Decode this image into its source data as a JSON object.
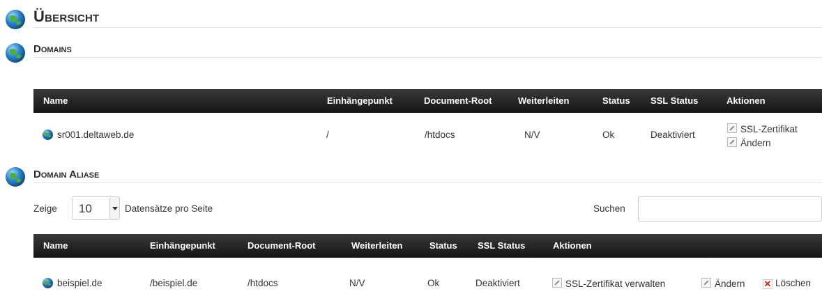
{
  "overview": {
    "title": "Übersicht"
  },
  "domains": {
    "title": "Domains",
    "headers": {
      "name": "Name",
      "mount": "Einhängepunkt",
      "docroot": "Document-Root",
      "redirect": "Weiterleiten",
      "status": "Status",
      "ssl": "SSL Status",
      "actions": "Aktionen"
    },
    "row": {
      "name": "sr001.deltaweb.de",
      "mount": "/",
      "docroot": "/htdocs",
      "redirect": "N/V",
      "status": "Ok",
      "ssl": "Deaktiviert",
      "action_ssl": "SSL-Zertifikat",
      "action_edit": "Ändern"
    }
  },
  "aliases": {
    "title": "Domain Aliase",
    "show_label": "Zeige",
    "page_size": "10",
    "per_page_label": "Datensätze pro Seite",
    "search_label": "Suchen",
    "search_value": "",
    "headers": {
      "name": "Name",
      "mount": "Einhängepunkt",
      "docroot": "Document-Root",
      "redirect": "Weiterleiten",
      "status": "Status",
      "ssl": "SSL Status",
      "actions": "Aktionen"
    },
    "row": {
      "name": "beispiel.de",
      "mount": "/beispiel.de",
      "docroot": "/htdocs",
      "redirect": "N/V",
      "status": "Ok",
      "ssl": "Deaktiviert",
      "action_ssl": "SSL-Zertifikat verwalten",
      "action_edit": "Ändern",
      "action_delete": "Löschen"
    }
  },
  "icons": {
    "section": "globe-icon",
    "edit": "edit-icon",
    "delete": "delete-icon"
  }
}
